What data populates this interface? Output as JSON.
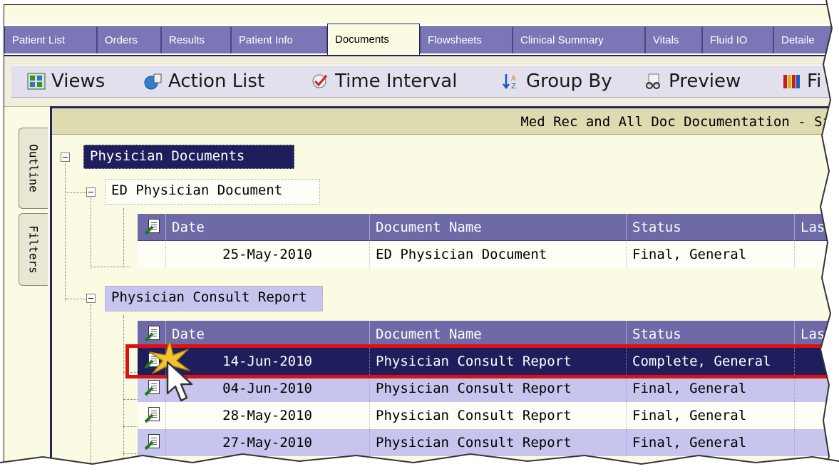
{
  "tabs": [
    {
      "label": "Patient List",
      "active": false
    },
    {
      "label": "Orders",
      "active": false
    },
    {
      "label": "Results",
      "active": false
    },
    {
      "label": "Patient Info",
      "active": false
    },
    {
      "label": "Documents",
      "active": true
    },
    {
      "label": "Flowsheets",
      "active": false
    },
    {
      "label": "Clinical Summary",
      "active": false
    },
    {
      "label": "Vitals",
      "active": false
    },
    {
      "label": "Fluid IO",
      "active": false
    },
    {
      "label": "Detaile",
      "active": false
    }
  ],
  "toolbar": {
    "views": "Views",
    "action_list": "Action List",
    "time_interval": "Time Interval",
    "group_by": "Group By",
    "preview": "Preview",
    "fi": "Fi"
  },
  "side_tabs": {
    "outline": "Outline",
    "filters": "Filters"
  },
  "panel_title": "Med Rec and All Doc Documentation - Si",
  "tree": {
    "root_label": "Physician Documents",
    "groups": [
      {
        "label": "ED Physician Document",
        "columns": [
          "Date",
          "Document Name",
          "Status",
          "Last"
        ],
        "rows": [
          {
            "date": "25-May-2010",
            "name": "ED Physician Document",
            "status": "Final, General",
            "last": ""
          }
        ]
      },
      {
        "label": "Physician Consult Report",
        "columns": [
          "Date",
          "Document Name",
          "Status",
          "Last"
        ],
        "rows": [
          {
            "date": "14-Jun-2010",
            "name": "Physician Consult Report",
            "status": "Complete, General",
            "last": "",
            "selected": true
          },
          {
            "date": "04-Jun-2010",
            "name": "Physician Consult Report",
            "status": "Final, General",
            "last": ""
          },
          {
            "date": "28-May-2010",
            "name": "Physician Consult Report",
            "status": "Final, General",
            "last": ""
          },
          {
            "date": "27-May-2010",
            "name": "Physician Consult Report",
            "status": "Final, General",
            "last": ""
          }
        ]
      }
    ]
  },
  "colors": {
    "tab_purple": "#7b77b6",
    "header_purple": "#6e6aa8",
    "selected_row": "#1f1e5c",
    "alt_row": "#c7c5ee",
    "highlight_red": "#e01010",
    "panel_bg": "#fbfbe3"
  }
}
